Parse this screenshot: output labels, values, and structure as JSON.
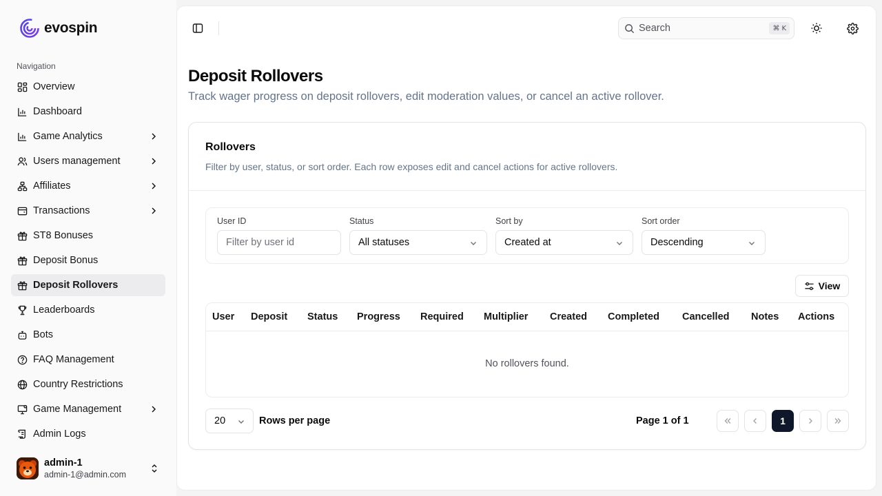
{
  "brand": {
    "name": "evospin"
  },
  "sidebar": {
    "section_label": "Navigation",
    "items": [
      {
        "label": "Overview",
        "icon": "grid-icon",
        "chevron": false,
        "active": false
      },
      {
        "label": "Dashboard",
        "icon": "bar-chart-icon",
        "chevron": false,
        "active": false
      },
      {
        "label": "Game Analytics",
        "icon": "bar-chart-icon",
        "chevron": true,
        "active": false
      },
      {
        "label": "Users management",
        "icon": "users-icon",
        "chevron": true,
        "active": false
      },
      {
        "label": "Affiliates",
        "icon": "network-icon",
        "chevron": true,
        "active": false
      },
      {
        "label": "Transactions",
        "icon": "wallet-icon",
        "chevron": true,
        "active": false
      },
      {
        "label": "ST8 Bonuses",
        "icon": "gift-icon",
        "chevron": false,
        "active": false
      },
      {
        "label": "Deposit Bonus",
        "icon": "gift-icon",
        "chevron": false,
        "active": false
      },
      {
        "label": "Deposit Rollovers",
        "icon": "gift-icon",
        "chevron": false,
        "active": true
      },
      {
        "label": "Leaderboards",
        "icon": "trophy-icon",
        "chevron": false,
        "active": false
      },
      {
        "label": "Bots",
        "icon": "bot-icon",
        "chevron": false,
        "active": false
      },
      {
        "label": "FAQ Management",
        "icon": "help-circle-icon",
        "chevron": false,
        "active": false
      },
      {
        "label": "Country Restrictions",
        "icon": "globe-icon",
        "chevron": false,
        "active": false
      },
      {
        "label": "Game Management",
        "icon": "monitor-icon",
        "chevron": true,
        "active": false
      },
      {
        "label": "Admin Logs",
        "icon": "scroll-icon",
        "chevron": false,
        "active": false
      }
    ]
  },
  "user": {
    "name": "admin-1",
    "email": "admin-1@admin.com"
  },
  "topbar": {
    "search_placeholder": "Search",
    "search_shortcut_mod": "⌘",
    "search_shortcut_key": "K"
  },
  "page": {
    "title": "Deposit Rollovers",
    "subtitle": "Track wager progress on deposit rollovers, edit moderation values, or cancel an active rollover."
  },
  "card": {
    "title": "Rollovers",
    "subtitle": "Filter by user, status, or sort order. Each row exposes edit and cancel actions for active rollovers."
  },
  "filters": {
    "user_id": {
      "label": "User ID",
      "placeholder": "Filter by user id"
    },
    "status": {
      "label": "Status",
      "value": "All statuses"
    },
    "sort_by": {
      "label": "Sort by",
      "value": "Created at"
    },
    "sort_order": {
      "label": "Sort order",
      "value": "Descending"
    }
  },
  "view_button": "View",
  "table": {
    "columns": [
      "User",
      "Deposit",
      "Status",
      "Progress",
      "Required",
      "Multiplier",
      "Created",
      "Completed",
      "Cancelled",
      "Notes",
      "Actions"
    ],
    "empty_text": "No rollovers found."
  },
  "pagination": {
    "rows_per_page_value": "20",
    "rows_per_page_label": "Rows per page",
    "page_info": "Page 1 of 1",
    "current_page": "1"
  }
}
